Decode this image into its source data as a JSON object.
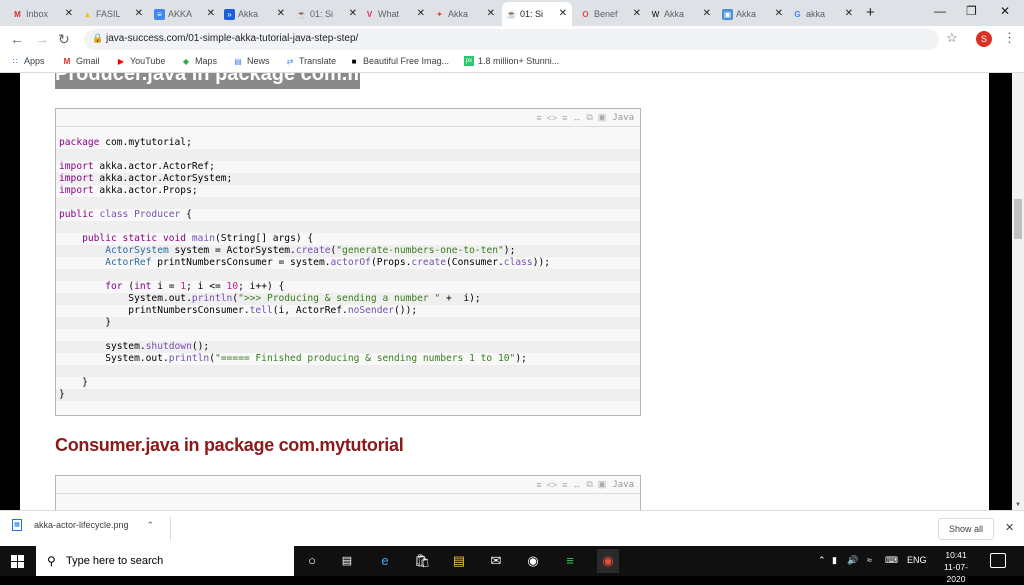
{
  "browser": {
    "tabs": [
      {
        "label": "Inbox",
        "favicon": "gmail-icon"
      },
      {
        "label": "FASIL",
        "favicon": "drive-icon"
      },
      {
        "label": "AKKA",
        "favicon": "docs-icon"
      },
      {
        "label": "Akka",
        "favicon": "akka-icon"
      },
      {
        "label": "01: Si",
        "favicon": "java-success-icon"
      },
      {
        "label": "What",
        "favicon": "v-icon"
      },
      {
        "label": "Akka",
        "favicon": "colorful-icon"
      },
      {
        "label": "01: Si",
        "favicon": "java-success-icon",
        "active": true
      },
      {
        "label": "Benef",
        "favicon": "o-icon"
      },
      {
        "label": "Akka",
        "favicon": "wikipedia-icon"
      },
      {
        "label": "Akka",
        "favicon": "blue-doc-icon"
      },
      {
        "label": "akka",
        "favicon": "google-icon"
      }
    ],
    "url": "java-success.com/01-simple-akka-tutorial-java-step-step/",
    "profile_initial": "S",
    "bookmarks": [
      {
        "label": "Apps",
        "icon": "apps-grid-icon"
      },
      {
        "label": "Gmail",
        "icon": "gmail-icon"
      },
      {
        "label": "YouTube",
        "icon": "youtube-icon"
      },
      {
        "label": "Maps",
        "icon": "maps-icon"
      },
      {
        "label": "News",
        "icon": "news-icon"
      },
      {
        "label": "Translate",
        "icon": "translate-icon"
      },
      {
        "label": "Beautiful Free Imag...",
        "icon": "unsplash-icon"
      },
      {
        "label": "1.8 million+ Stunni...",
        "icon": "pixabay-icon"
      }
    ]
  },
  "page": {
    "heading_cut": "Producer.java in package com.mytutorial",
    "code_lang": "Java",
    "code_lines": [
      "package com.mytutorial;",
      "",
      "import akka.actor.ActorRef;",
      "import akka.actor.ActorSystem;",
      "import akka.actor.Props;",
      "",
      "public class Producer {",
      "",
      "    public static void main(String[] args) {",
      "        ActorSystem system = ActorSystem.create(\"generate-numbers-one-to-ten\");",
      "        ActorRef printNumbersConsumer = system.actorOf(Props.create(Consumer.class));",
      "",
      "        for (int i = 1; i <= 10; i++) {",
      "            System.out.println(\">>> Producing & sending a number \" +  i);",
      "            printNumbersConsumer.tell(i, ActorRef.noSender());",
      "        }",
      "",
      "        system.shutdown();",
      "        System.out.println(\"===== Finished producing & sending numbers 1 to 10\");",
      "",
      "    }",
      "}"
    ],
    "heading2": "Consumer.java in package com.mytutorial",
    "code_lang2": "Java"
  },
  "downloads": {
    "file": "akka-actor-lifecycle.png",
    "show_all": "Show all"
  },
  "taskbar": {
    "search_placeholder": "Type here to search",
    "lang": "ENG",
    "time": "10:41",
    "date": "11-07-2020"
  }
}
